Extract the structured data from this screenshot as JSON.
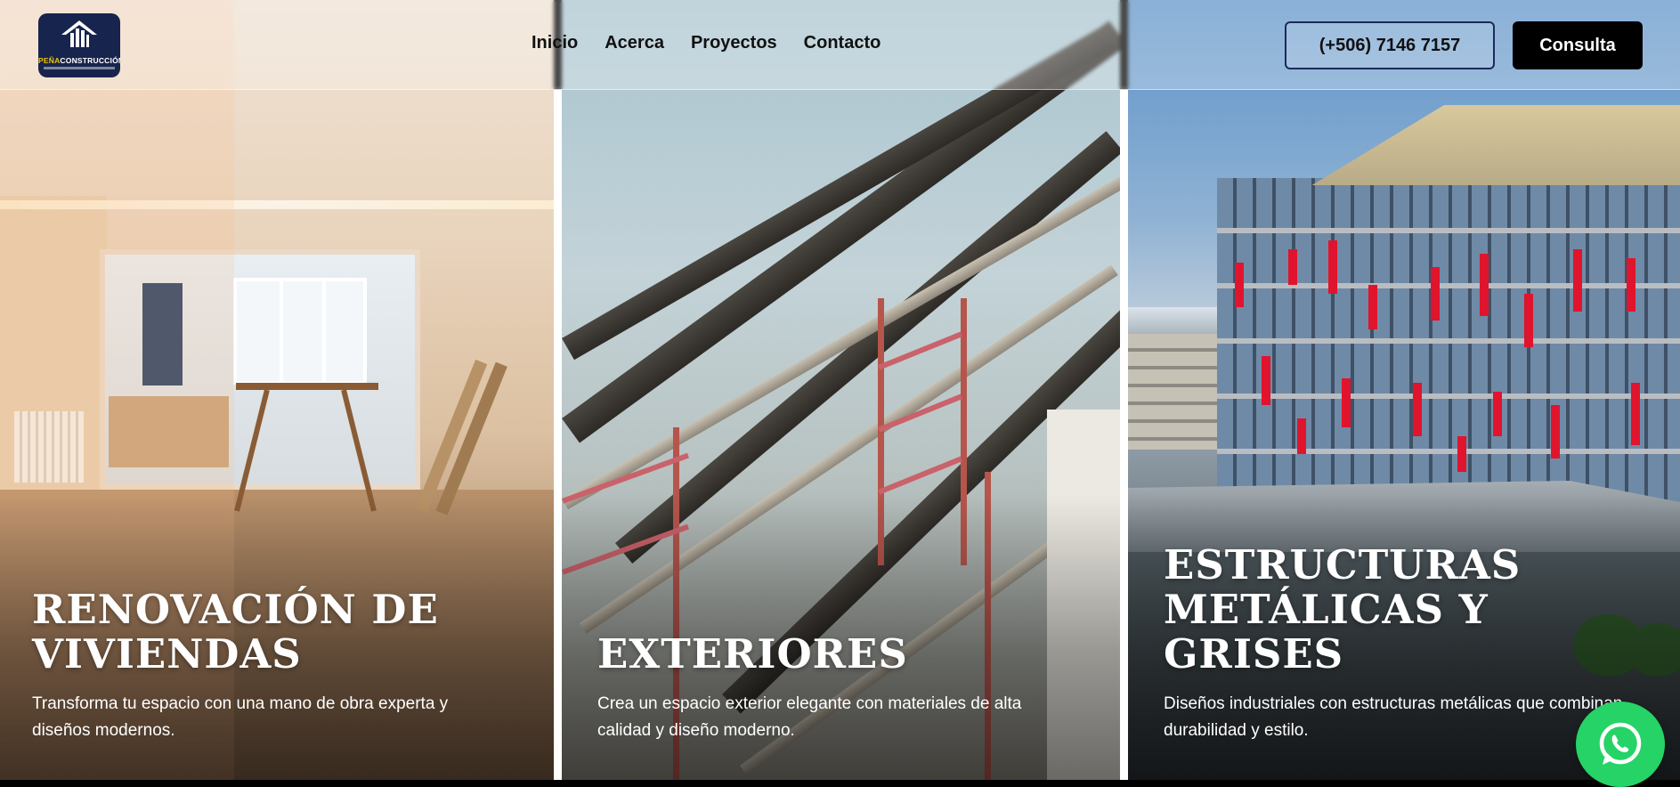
{
  "header": {
    "logo": {
      "name_part1": "PEÑA",
      "name_part2": "CONSTRUCCIÓN"
    },
    "nav": [
      {
        "label": "Inicio"
      },
      {
        "label": "Acerca"
      },
      {
        "label": "Proyectos"
      },
      {
        "label": "Contacto"
      }
    ],
    "phone_label": "(+506) 7146 7157",
    "consult_label": "Consulta"
  },
  "panels": [
    {
      "title": "RENOVACIÓN DE VIVIENDAS",
      "description": "Transforma tu espacio con una mano de obra experta y diseños modernos."
    },
    {
      "title": "EXTERIORES",
      "description": "Crea un espacio exterior elegante con materiales de alta calidad y diseño moderno."
    },
    {
      "title": "ESTRUCTURAS METÁLICAS Y GRISES",
      "description": "Diseños industriales con estructuras metálicas que combinan durabilidad y estilo."
    }
  ],
  "floating": {
    "icon": "whatsapp-icon"
  },
  "colors": {
    "nav_text": "#111111",
    "consult_bg": "#000000",
    "whatsapp": "#25d366",
    "logo_bg": "#17244d",
    "logo_accent": "#f2c200"
  }
}
